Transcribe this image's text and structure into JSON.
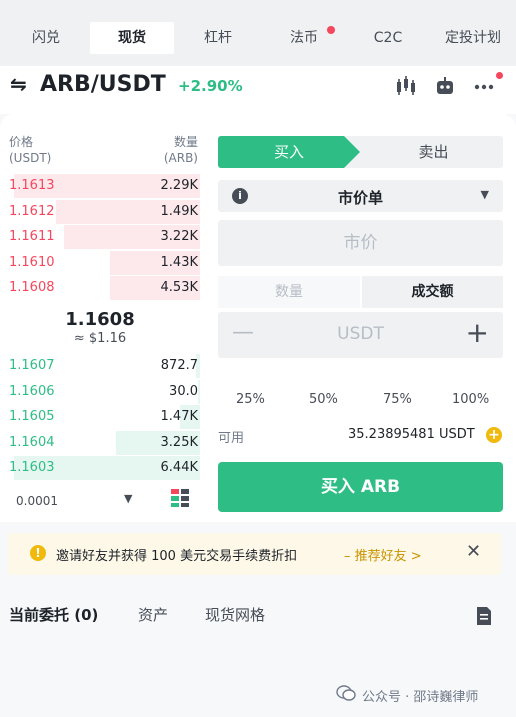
{
  "top_tabs": [
    {
      "label": "闪兑"
    },
    {
      "label": "现货",
      "active": true
    },
    {
      "label": "杠杆"
    },
    {
      "label": "法币",
      "has_dot": true
    },
    {
      "label": "C2C"
    },
    {
      "label": "定投计划"
    }
  ],
  "header": {
    "swap_glyph": "⇋",
    "pair": "ARB/USDT",
    "change": "+2.90%",
    "icons": [
      "candlestick-chart-icon",
      "bot-icon",
      "more-icon"
    ]
  },
  "order_book": {
    "price_header": "价格",
    "price_unit": "(USDT)",
    "qty_header": "数量",
    "qty_unit": "(ARB)",
    "asks": [
      {
        "price": "1.1613",
        "qty": "2.29K",
        "depth": 0.93
      },
      {
        "price": "1.1612",
        "qty": "1.49K",
        "depth": 0.72
      },
      {
        "price": "1.1611",
        "qty": "3.22K",
        "depth": 0.68
      },
      {
        "price": "1.1610",
        "qty": "1.43K",
        "depth": 0.45
      },
      {
        "price": "1.1608",
        "qty": "4.53K",
        "depth": 0.45
      }
    ],
    "last_price": "1.1608",
    "last_usd": "≈ $1.16",
    "bids": [
      {
        "price": "1.1607",
        "qty": "872.7",
        "depth": 0.02
      },
      {
        "price": "1.1606",
        "qty": "30.0",
        "depth": 0.01
      },
      {
        "price": "1.1605",
        "qty": "1.47K",
        "depth": 0.1
      },
      {
        "price": "1.1604",
        "qty": "3.25K",
        "depth": 0.42
      },
      {
        "price": "1.1603",
        "qty": "6.44K",
        "depth": 0.93
      }
    ],
    "precision": "0.0001"
  },
  "order_form": {
    "buy_tab": "买入",
    "sell_tab": "卖出",
    "order_type": "市价单",
    "price_placeholder": "市价",
    "mode_qty": "数量",
    "mode_total": "成交额",
    "amount_unit": "USDT",
    "minus": "—",
    "plus": "+",
    "percents": [
      "25%",
      "50%",
      "75%",
      "100%"
    ],
    "available_label": "可用",
    "available_value": "35.23895481 USDT",
    "buy_button": "买入 ARB"
  },
  "banner": {
    "message": "邀请好友并获得 100 美元交易手续费折扣",
    "link": "– 推荐好友 >",
    "close": "✕"
  },
  "bottom_tabs": [
    {
      "label": "当前委托 (0)",
      "active": true
    },
    {
      "label": "资产"
    },
    {
      "label": "现货网格"
    }
  ],
  "watermark": "公众号 · 邵诗巍律师",
  "colors": {
    "green": "#2ebd85",
    "red": "#f6465d",
    "gold": "#f0b90b"
  }
}
